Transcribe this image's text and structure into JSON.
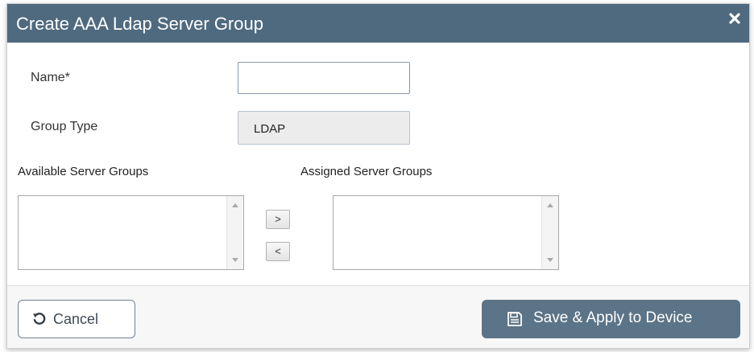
{
  "dialog": {
    "title": "Create AAA Ldap Server Group",
    "close_icon": "close-icon"
  },
  "form": {
    "name_label": "Name*",
    "name_value": "",
    "group_type_label": "Group Type",
    "group_type_value": "LDAP"
  },
  "transfer": {
    "available_label": "Available Server Groups",
    "assigned_label": "Assigned Server Groups",
    "available_items": [],
    "assigned_items": [],
    "move_right_label": ">",
    "move_left_label": "<"
  },
  "footer": {
    "cancel_label": "Cancel",
    "cancel_icon": "undo-icon",
    "save_label": "Save & Apply to Device",
    "save_icon": "save-icon"
  },
  "colors": {
    "titlebar": "#4f6a7f",
    "primary_button": "#5b7487"
  }
}
